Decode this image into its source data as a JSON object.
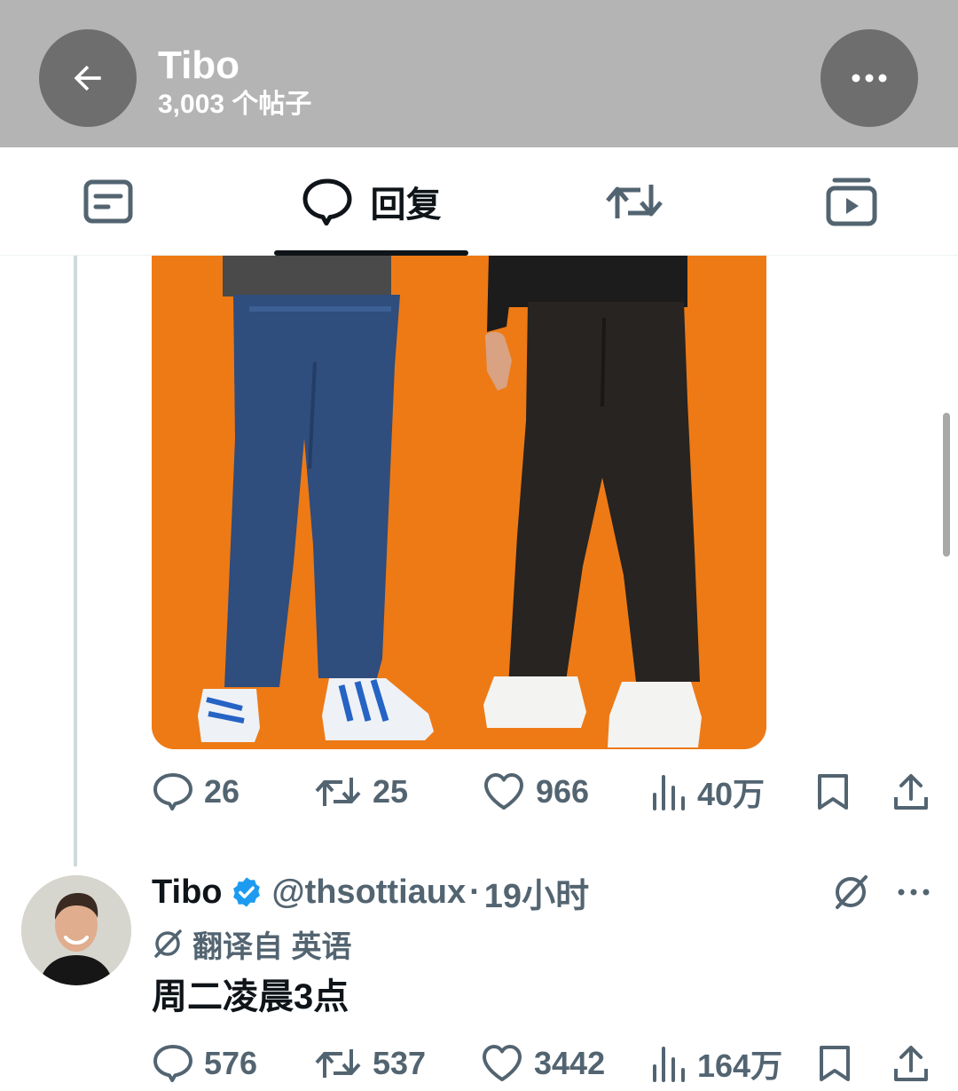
{
  "header": {
    "title": "Tibo",
    "subtitle": "3,003 个帖子",
    "back_icon": "arrow-left-icon",
    "more_icon": "more-horizontal-icon"
  },
  "tabs": [
    {
      "name": "posts",
      "icon": "posts-icon",
      "label": ""
    },
    {
      "name": "replies",
      "icon": "reply-bubble-icon",
      "label": "回复",
      "active": true
    },
    {
      "name": "reposts",
      "icon": "repost-icon",
      "label": ""
    },
    {
      "name": "media",
      "icon": "video-icon",
      "label": ""
    }
  ],
  "first_post": {
    "media_background": "#ee7a15",
    "actions": {
      "replies": "26",
      "reposts": "25",
      "likes": "966",
      "views": "40万"
    }
  },
  "reply_post": {
    "name": "Tibo",
    "verified": true,
    "handle": "@thsottiaux",
    "separator": "·",
    "time": "19小时",
    "translated_from": "翻译自 英语",
    "text": "周二凌晨3点",
    "actions": {
      "replies": "576",
      "reposts": "537",
      "likes": "3442",
      "views": "164万"
    }
  },
  "colors": {
    "header_bg": "#b4b4b4",
    "text_primary": "#0f1419",
    "text_secondary": "#536471",
    "verified_blue": "#1d9bf0"
  }
}
